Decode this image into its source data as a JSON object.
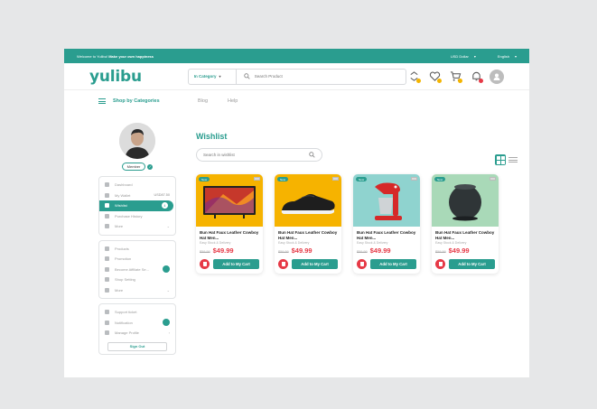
{
  "topbar": {
    "welcome_prefix": "Welcome to Yulibu!",
    "welcome_bold": "Make your own happiness",
    "currency": "USD Dollar",
    "language": "English"
  },
  "header": {
    "logo": "yulibu",
    "category_select": "In Category",
    "search_placeholder": "Search Product",
    "icons": [
      "compare-icon",
      "heart-icon",
      "cart-icon",
      "bell-icon",
      "user-avatar"
    ],
    "badge_colors": [
      "#f4b400",
      "#f4b400",
      "#f4b400",
      "#e63946"
    ]
  },
  "subnav": {
    "shop_by_categories": "Shop by Categories",
    "links": [
      "Blog",
      "Help"
    ]
  },
  "sidebar": {
    "member_badge": "Member",
    "group1": [
      {
        "label": "Dashboard",
        "icon": "home-icon"
      },
      {
        "label": "My Wallet",
        "icon": "wallet-icon",
        "value": "USD87.50"
      },
      {
        "label": "Wishlist",
        "icon": "heart-icon",
        "count": "4",
        "active": true
      },
      {
        "label": "Purchase History",
        "icon": "cart-icon"
      },
      {
        "label": "More",
        "icon": "dots-icon",
        "chevron": true
      }
    ],
    "group2": [
      {
        "label": "Products",
        "icon": "box-icon"
      },
      {
        "label": "Promotion",
        "icon": "tag-icon"
      },
      {
        "label": "Become Affiliate Se...",
        "icon": "link-icon",
        "toggle": true
      },
      {
        "label": "Shop Setting",
        "icon": "store-icon"
      },
      {
        "label": "More",
        "icon": "dots-icon",
        "chevron": true
      }
    ],
    "group3": [
      {
        "label": "Support ticket",
        "icon": "ticket-icon"
      },
      {
        "label": "Notification",
        "icon": "bell-icon",
        "toggle": true
      },
      {
        "label": "Manage Profile",
        "icon": "user-icon",
        "chevron": true
      }
    ],
    "sign_out": "Sign Out"
  },
  "main": {
    "title": "Wishlist",
    "search_placeholder": "Search in wishlist",
    "products": [
      {
        "tag": "New",
        "title": "Bun Hat Faux Leather Cowboy Hat Men...",
        "subtitle": "Easy Stock & Delivery",
        "old_price": "$59.99",
        "price": "$49.99",
        "add_label": "Add to My Cart",
        "bg": "#f6b300",
        "kind": "tv"
      },
      {
        "tag": "New",
        "title": "Bun Hat Faux Leather Cowboy Hat Men...",
        "subtitle": "Easy Stock & Delivery",
        "old_price": "$59.99",
        "price": "$49.99",
        "add_label": "Add to My Cart",
        "bg": "#f6b300",
        "kind": "shoe"
      },
      {
        "tag": "New",
        "title": "Bun Hat Faux Leather Cowboy Hat Men...",
        "subtitle": "Easy Stock & Delivery",
        "old_price": "$59.99",
        "price": "$49.99",
        "add_label": "Add to My Cart",
        "bg": "#8fd3cf",
        "kind": "mixer"
      },
      {
        "tag": "New",
        "title": "Bun Hat Faux Leather Cowboy Hat Men...",
        "subtitle": "Easy Stock & Delivery",
        "old_price": "$59.99",
        "price": "$49.99",
        "add_label": "Add to My Cart",
        "bg": "#a9d9b8",
        "kind": "speaker"
      }
    ]
  }
}
